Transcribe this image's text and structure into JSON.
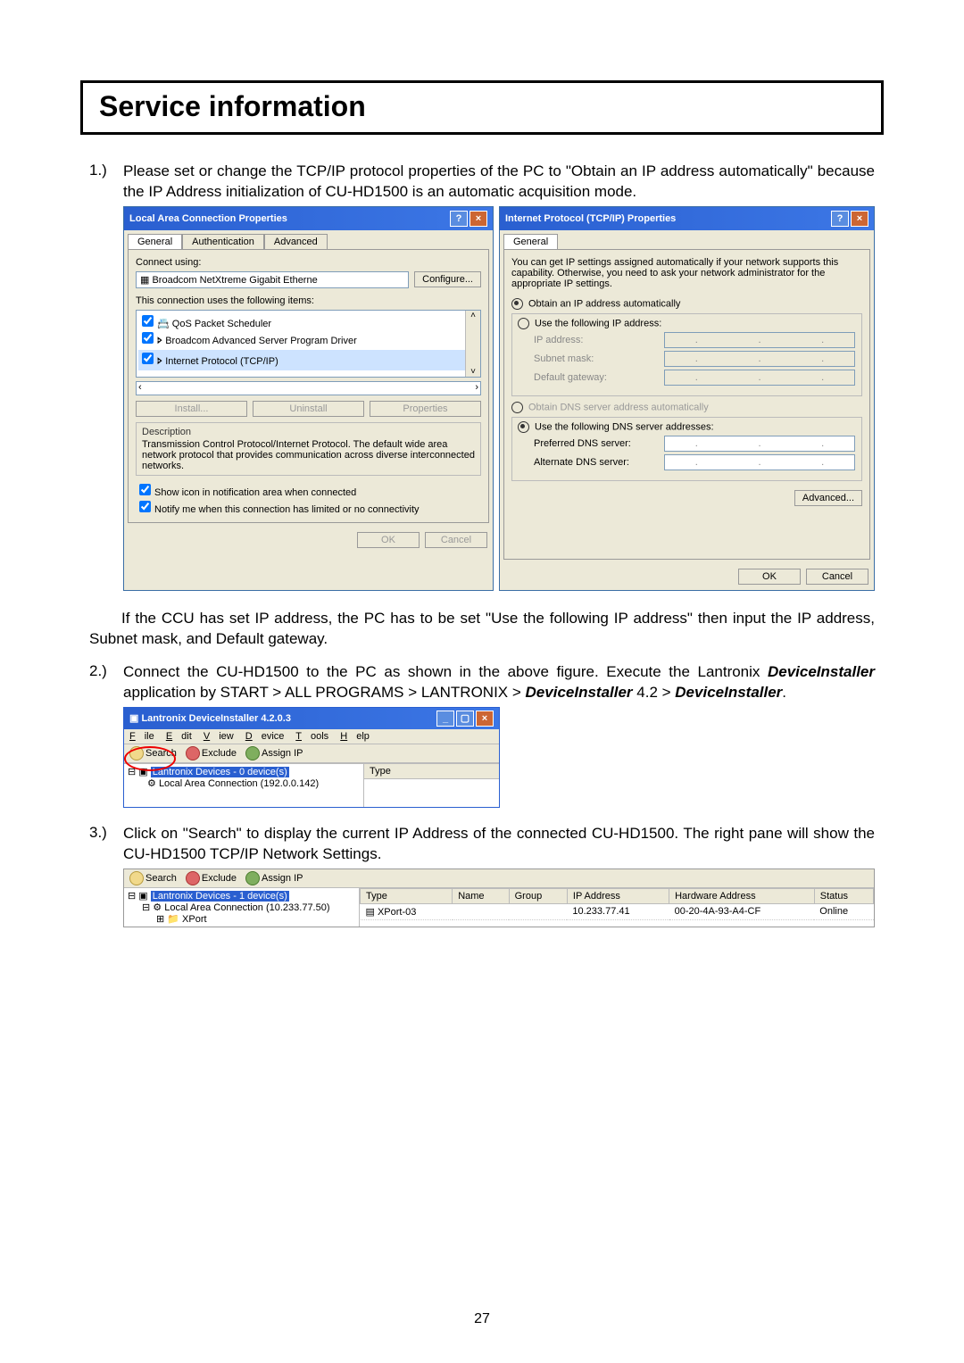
{
  "title": "Service information",
  "p1_num": "1.)",
  "p1": "Please set or change the TCP/IP protocol properties of the PC to \"Obtain an IP address automatically\" because the IP Address initialization of CU-HD1500 is an automatic acquisition mode.",
  "dlg1": {
    "title": "Local Area Connection Properties",
    "tabs": {
      "general": "General",
      "auth": "Authentication",
      "adv": "Advanced"
    },
    "connect_using": "Connect using:",
    "adapter": "Broadcom NetXtreme Gigabit Etherne",
    "configure": "Configure...",
    "uses": "This connection uses the following items:",
    "item1": "QoS Packet Scheduler",
    "item2": "Broadcom Advanced Server Program Driver",
    "item3": "Internet Protocol (TCP/IP)",
    "install": "Install...",
    "uninstall": "Uninstall",
    "properties": "Properties",
    "desc_h": "Description",
    "desc": "Transmission Control Protocol/Internet Protocol. The default wide area network protocol that provides communication across diverse interconnected networks.",
    "show_icon": "Show icon in notification area when connected",
    "notify": "Notify me when this connection has limited or no connectivity",
    "ok": "OK",
    "cancel": "Cancel"
  },
  "dlg2": {
    "title": "Internet Protocol (TCP/IP) Properties",
    "tab": "General",
    "blurb": "You can get IP settings assigned automatically if your network supports this capability. Otherwise, you need to ask your network administrator for the appropriate IP settings.",
    "r1": "Obtain an IP address automatically",
    "r2": "Use the following IP address:",
    "ip": "IP address:",
    "mask": "Subnet mask:",
    "gw": "Default gateway:",
    "r3": "Obtain DNS server address automatically",
    "r4": "Use the following DNS server addresses:",
    "pdns": "Preferred DNS server:",
    "adns": "Alternate DNS server:",
    "adv": "Advanced...",
    "ok": "OK",
    "cancel": "Cancel"
  },
  "p_mid": "If the CCU has set IP address, the PC has to be set \"Use the following IP address\" then input the IP address, Subnet mask, and Default gateway.",
  "p2_num": "2.)",
  "p2a": "Connect the CU-HD1500 to the PC as shown in the above figure.  Execute the Lantronix ",
  "p2b": "DeviceInstaller",
  "p2c": " application by START > ALL PROGRAMS > LANTRONIX > ",
  "p2d": "DeviceInstaller",
  "p2e": " 4.2 > ",
  "p2f": "DeviceInstaller",
  "p2g": ".",
  "di": {
    "title": "Lantronix DeviceInstaller 4.2.0.3",
    "menu": {
      "file": "File",
      "edit": "Edit",
      "view": "View",
      "device": "Device",
      "tools": "Tools",
      "help": "Help"
    },
    "tool": {
      "search": "Search",
      "exclude": "Exclude",
      "assign": "Assign IP"
    },
    "tree1": "Lantronix Devices - 0 device(s)",
    "tree2": "Local Area Connection (192.0.0.142)",
    "col": "Type"
  },
  "p3_num": "3.)",
  "p3": "Click on \"Search\" to display the current IP Address of the connected CU-HD1500.   The right pane will show the CU-HD1500 TCP/IP Network Settings.",
  "wide": {
    "tool": {
      "search": "Search",
      "exclude": "Exclude",
      "assign": "Assign IP"
    },
    "tree1": "Lantronix Devices - 1 device(s)",
    "tree2": "Local Area Connection (10.233.77.50)",
    "tree3": "XPort",
    "cols": {
      "type": "Type",
      "name": "Name",
      "group": "Group",
      "ip": "IP Address",
      "hw": "Hardware Address",
      "status": "Status"
    },
    "row": {
      "type": "XPort-03",
      "name": "",
      "group": "",
      "ip": "10.233.77.41",
      "hw": "00-20-4A-93-A4-CF",
      "status": "Online"
    }
  },
  "pagenum": "27"
}
